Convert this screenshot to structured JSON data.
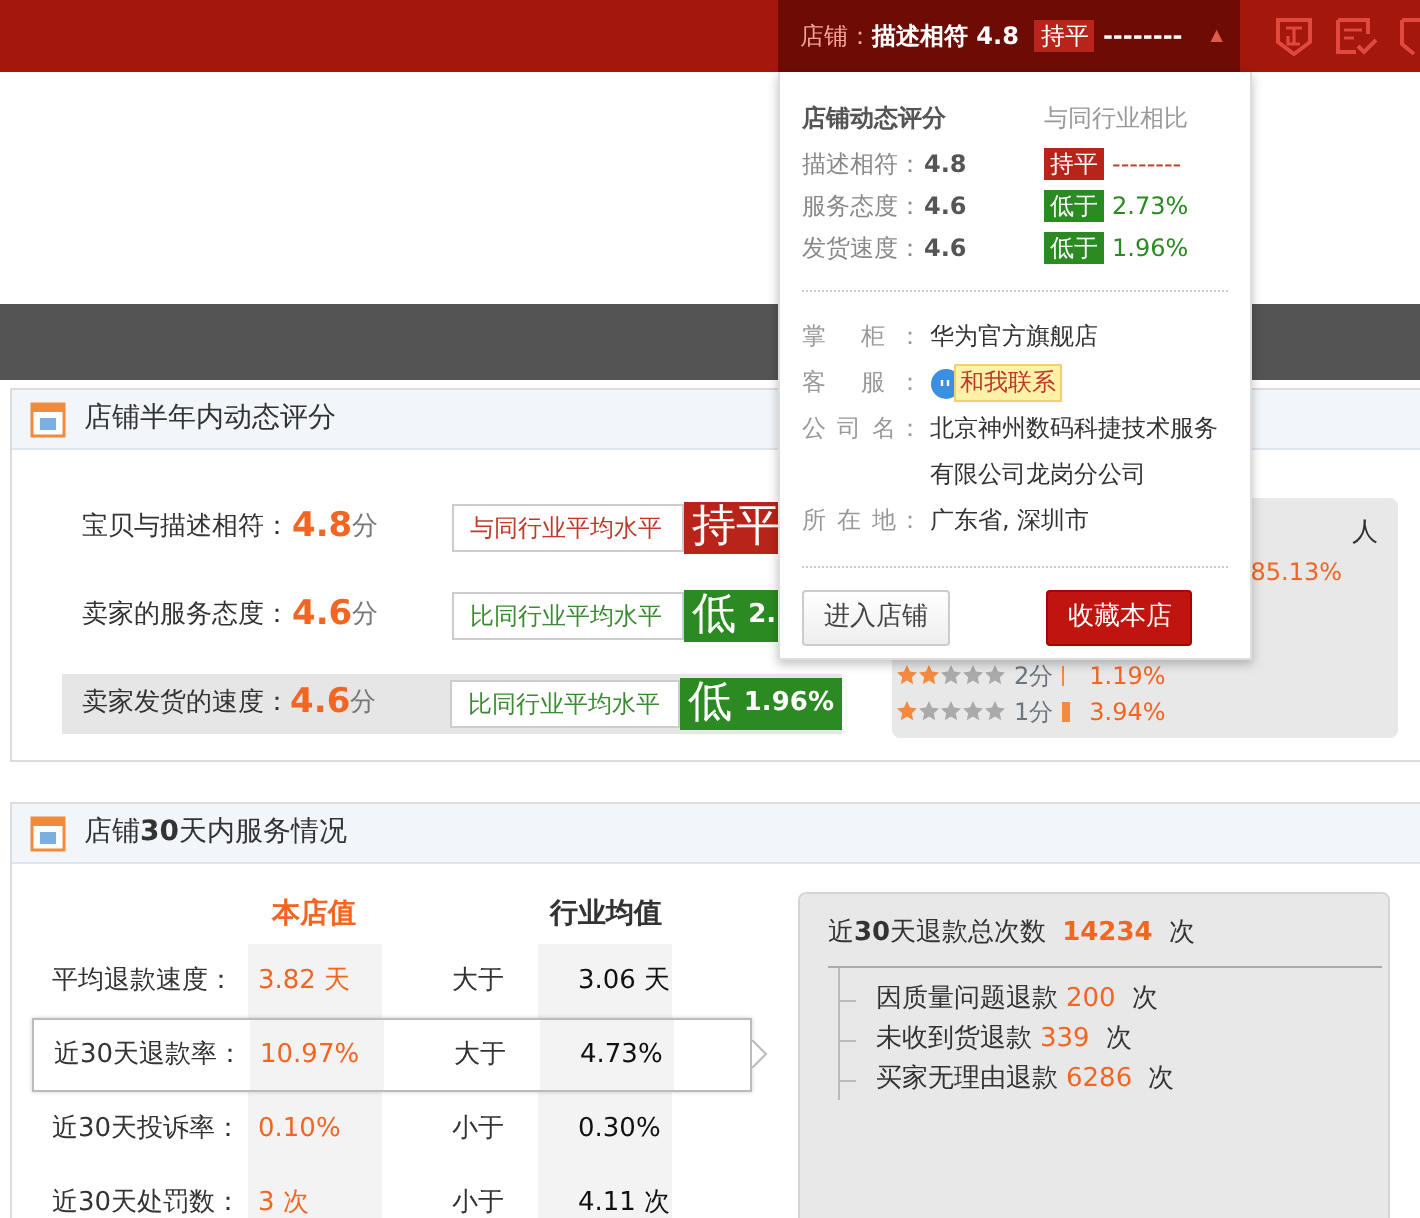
{
  "header": {
    "shop_label": "店铺：",
    "metric": "描述相符",
    "score": "4.8",
    "badge": "持平",
    "kind": "flat",
    "diff": "--------",
    "caret": "▲"
  },
  "popup": {
    "title": "店铺动态评分",
    "compare_title": "与同行业相比",
    "ratings": [
      {
        "label": "描述相符：",
        "score": "4.8",
        "badge": "持平",
        "kind": "flat",
        "diff": "--------"
      },
      {
        "label": "服务态度：",
        "score": "4.6",
        "badge": "低于",
        "kind": "low",
        "diff": "2.73%"
      },
      {
        "label": "发货速度：",
        "score": "4.6",
        "badge": "低于",
        "kind": "low",
        "diff": "1.96%"
      }
    ],
    "info": [
      {
        "label": "掌 柜：",
        "value": "华为官方旗舰店",
        "kind": "text"
      },
      {
        "label": "客 服：",
        "value": "和我联系",
        "kind": "contact"
      },
      {
        "label": "公 司 名：",
        "value": "北京神州数码科捷技术服务有限公司龙岗分公司",
        "kind": "text"
      },
      {
        "label": "所 在 地：",
        "value": "广东省, 深圳市",
        "kind": "text"
      }
    ],
    "buttons": [
      {
        "label": "进入店铺",
        "kind": "secondary"
      },
      {
        "label": "收藏本店",
        "kind": "primary"
      }
    ]
  },
  "ratings_section": {
    "title": "店铺半年内动态评分",
    "rows": [
      {
        "label": "宝贝与描述相符：",
        "score": "4.8",
        "unit": "分",
        "compare": "与同行业平均水平",
        "kind": "flat",
        "badge": "持平",
        "selected": false
      },
      {
        "label": "卖家的服务态度：",
        "score": "4.6",
        "unit": "分",
        "compare": "比同行业平均水平",
        "kind": "low",
        "badge": "低",
        "badge_value": "2.",
        "selected": false
      },
      {
        "label": "卖家发货的速度：",
        "score": "4.6",
        "unit": "分",
        "compare": "比同行业平均水平",
        "kind": "low",
        "badge": "低",
        "badge_value": "1.96%",
        "selected": true
      }
    ],
    "distribution": {
      "top_text": "人",
      "top_percent": "85.13%",
      "rows": [
        {
          "stars": 2,
          "label": "2分",
          "percent": "1.19%"
        },
        {
          "stars": 1,
          "label": "1分",
          "percent": "3.94%"
        }
      ]
    }
  },
  "service_section": {
    "title": "店铺**30**天内服务情况",
    "columns": [
      "本店值",
      "行业均值"
    ],
    "rows": [
      {
        "label": "平均退款速度：",
        "value": "3.82 天",
        "compare": "大于",
        "industry": "3.06 天",
        "selected": false
      },
      {
        "label": "近30天退款率：",
        "value": "10.97%",
        "compare": "大于",
        "industry": "4.73%",
        "selected": true
      },
      {
        "label": "近30天投诉率：",
        "value": "0.10%",
        "compare": "小于",
        "industry": "0.30%",
        "selected": false
      },
      {
        "label": "近30天处罚数：",
        "value": "3 次",
        "compare": "小于",
        "industry": "4.11 次",
        "selected": false
      }
    ],
    "summary": {
      "title": "近**30**天退款总次数",
      "count": "14234",
      "unit": "次",
      "items": [
        {
          "label": "因质量问题退款",
          "count": "200",
          "unit": "次"
        },
        {
          "label": "未收到货退款",
          "count": "339",
          "unit": "次"
        },
        {
          "label": "买家无理由退款",
          "count": "6286",
          "unit": "次"
        }
      ]
    }
  }
}
